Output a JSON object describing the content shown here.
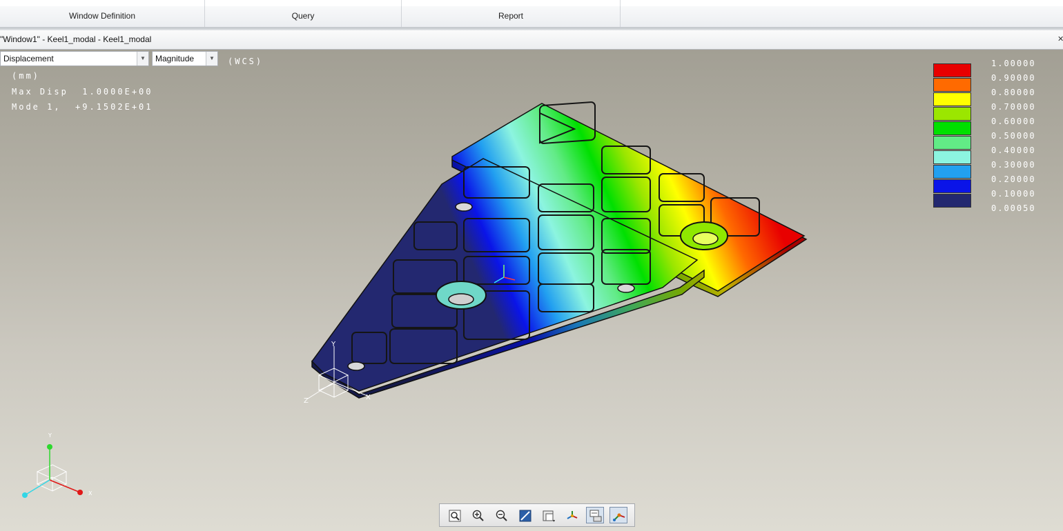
{
  "ribbon": {
    "groups": [
      {
        "label": "Window Definition"
      },
      {
        "label": "Query"
      },
      {
        "label": "Report"
      }
    ]
  },
  "window": {
    "title": "\"Window1\" - Keel1_modal - Keel1_modal"
  },
  "viewport": {
    "result_quantity": "Displacement",
    "component": "Magnitude",
    "coord_system": "(WCS)",
    "units": "(mm)",
    "max_disp": "Max Disp  1.0000E+00",
    "mode": "Mode 1,  +9.1502E+01",
    "triad_labels": {
      "x": "X",
      "y": "Y",
      "z": "Z"
    }
  },
  "legend": {
    "values": [
      "1.00000",
      "0.90000",
      "0.80000",
      "0.70000",
      "0.60000",
      "0.50000",
      "0.40000",
      "0.30000",
      "0.20000",
      "0.10000",
      "0.00050"
    ],
    "colors": [
      "#e80000",
      "#ff6a00",
      "#ffff00",
      "#9be600",
      "#00e000",
      "#62eb86",
      "#8cf4e0",
      "#22a0f0",
      "#0a14e8",
      "#232870"
    ]
  },
  "toolbar": {
    "buttons": [
      {
        "icon": "refit-icon"
      },
      {
        "icon": "zoom-in-icon"
      },
      {
        "icon": "zoom-out-icon"
      },
      {
        "icon": "repaint-icon"
      },
      {
        "icon": "saved-views-icon"
      },
      {
        "icon": "spin-center-icon"
      },
      {
        "icon": "annotation-display-icon",
        "active": true
      },
      {
        "icon": "datum-display-icon",
        "active": true
      }
    ]
  }
}
